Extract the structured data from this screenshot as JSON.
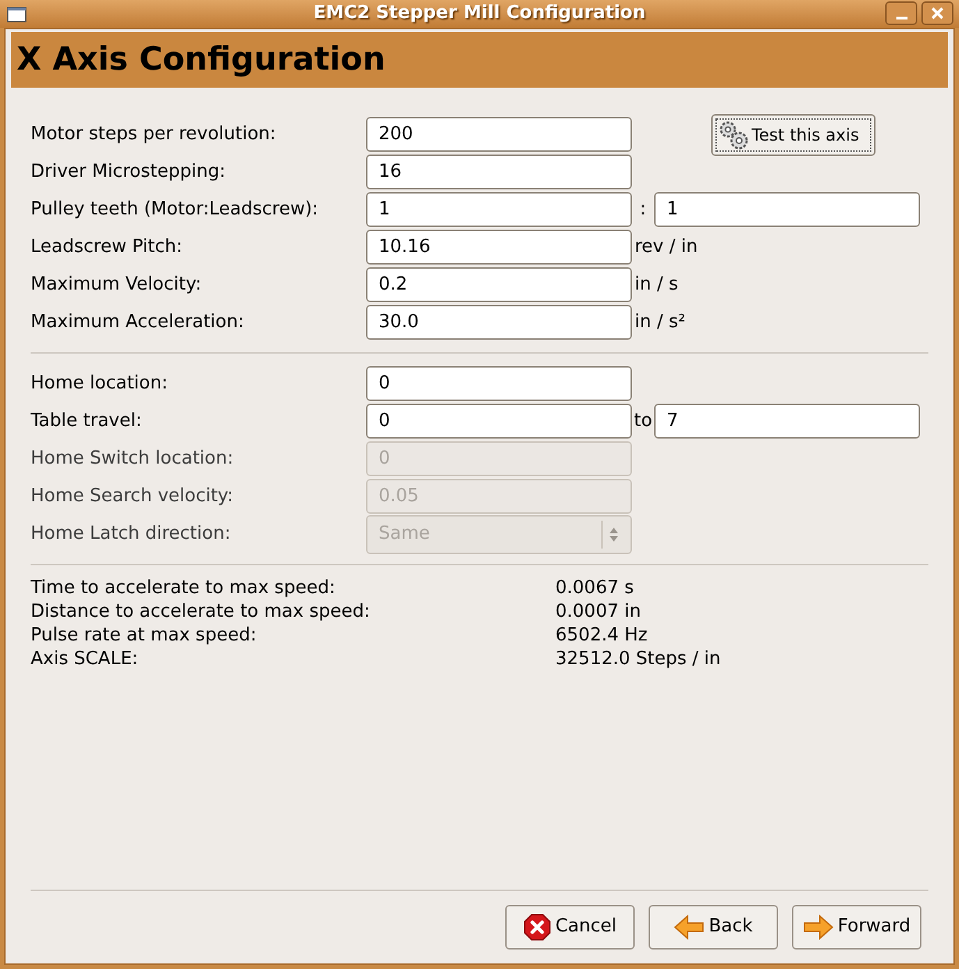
{
  "window": {
    "title": "EMC2 Stepper Mill Configuration"
  },
  "header": "X Axis Configuration",
  "test_button": "Test this axis",
  "motor_rows": [
    {
      "kind": "entry",
      "label": "Motor steps per revolution:",
      "value": "200",
      "disabled": false
    },
    {
      "kind": "entry",
      "label": "Driver Microstepping:",
      "value": "16",
      "disabled": false
    },
    {
      "kind": "pair",
      "label": "Pulley teeth (Motor:Leadscrew):",
      "value": "1",
      "separator": ":",
      "value2": "1",
      "disabled": false
    },
    {
      "kind": "entry",
      "label": "Leadscrew Pitch:",
      "value": "10.16",
      "unit": "rev / in",
      "disabled": false
    },
    {
      "kind": "entry",
      "label": "Maximum Velocity:",
      "value": "0.2",
      "unit": "in / s",
      "disabled": false
    },
    {
      "kind": "entry",
      "label": "Maximum Acceleration:",
      "value": "30.0",
      "unit": "in / s²",
      "disabled": false
    }
  ],
  "home_rows": [
    {
      "kind": "entry",
      "label": "Home location:",
      "value": "0",
      "disabled": false
    },
    {
      "kind": "pair",
      "label": "Table travel:",
      "value": "0",
      "separator": "to",
      "value2": "7",
      "disabled": false
    },
    {
      "kind": "entry",
      "label": "Home Switch location:",
      "value": "0",
      "disabled": true
    },
    {
      "kind": "entry",
      "label": "Home Search velocity:",
      "value": "0.05",
      "disabled": true
    },
    {
      "kind": "combo",
      "label": "Home Latch direction:",
      "value": "Same",
      "disabled": true
    }
  ],
  "results": [
    {
      "label": "Time to accelerate to max speed:",
      "value": "0.0067 s"
    },
    {
      "label": "Distance to accelerate to max speed:",
      "value": "0.0007 in"
    },
    {
      "label": "Pulse rate at max speed:",
      "value": "6502.4 Hz"
    },
    {
      "label": "Axis SCALE:",
      "value": "32512.0 Steps / in"
    }
  ],
  "buttons": [
    {
      "kind": "cancel",
      "label": "Cancel"
    },
    {
      "kind": "back",
      "label": "Back"
    },
    {
      "kind": "forward",
      "label": "Forward"
    }
  ]
}
